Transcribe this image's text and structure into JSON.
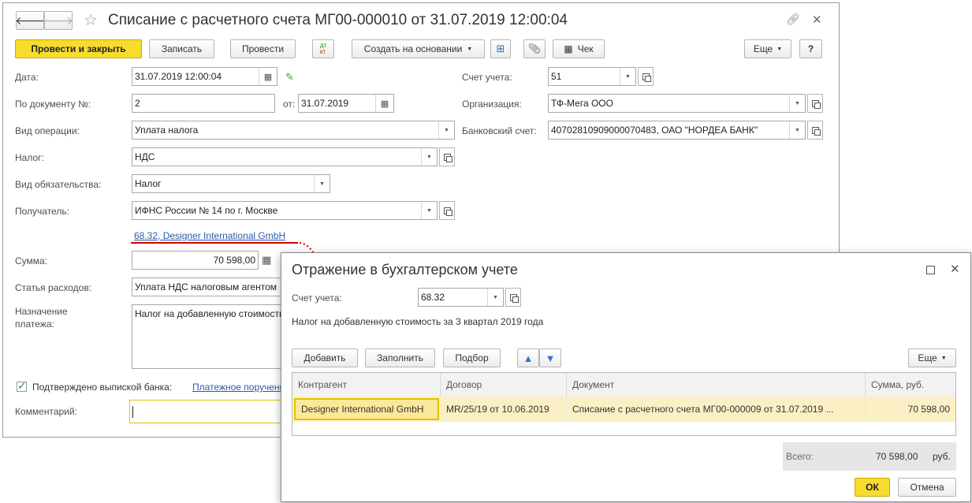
{
  "main": {
    "title": "Списание с расчетного счета МГ00-000010 от 31.07.2019 12:00:04",
    "toolbar": {
      "post_close": "Провести и закрыть",
      "save": "Записать",
      "post": "Провести",
      "dtkt_top": "дт",
      "dtkt_bottom": "кт",
      "create_based": "Создать на основании",
      "check": "Чек",
      "more": "Еще",
      "help": "?"
    },
    "fields": {
      "date_label": "Дата:",
      "date_value": "31.07.2019 12:00:04",
      "docnum_label": "По документу №:",
      "docnum_value": "2",
      "from_label": "от:",
      "from_value": "31.07.2019",
      "optype_label": "Вид операции:",
      "optype_value": "Уплата налога",
      "tax_label": "Налог:",
      "tax_value": "НДС",
      "liability_label": "Вид обязательства:",
      "liability_value": "Налог",
      "recipient_label": "Получатель:",
      "recipient_value": "ИФНС России № 14 по г. Москве",
      "account_link": "68.32, Designer International GmbH",
      "amount_label": "Сумма:",
      "amount_value": "70 598,00",
      "expense_label": "Статья расходов:",
      "expense_value": "Уплата НДС налоговым агентом",
      "purpose_label": "Назначение платежа:",
      "purpose_value": "Налог на добавленную стоимость",
      "bank_confirm": "Подтверждено выпиской банка:",
      "payment_order_link": "Платежное поручение",
      "comment_label": "Комментарий:",
      "comment_value": "",
      "acc_label": "Счет учета:",
      "acc_value": "51",
      "org_label": "Организация:",
      "org_value": "ТФ-Мега ООО",
      "bank_label": "Банковский счет:",
      "bank_value": "40702810909000070483, ОАО \"НОРДЕА БАНК\""
    }
  },
  "dialog": {
    "title": "Отражение в бухгалтерском учете",
    "acc_label": "Счет учета:",
    "acc_value": "68.32",
    "acc_desc": "Налог на добавленную стоимость за 3 квартал 2019 года",
    "toolbar": {
      "add": "Добавить",
      "fill": "Заполнить",
      "pick": "Подбор",
      "more": "Еще"
    },
    "table": {
      "headers": [
        "Контрагент",
        "Договор",
        "Документ",
        "Сумма, руб."
      ],
      "rows": [
        [
          "Designer International GmbH",
          "MR/25/19 от 10.06.2019",
          "Списание с расчетного счета МГ00-000009 от 31.07.2019 ...",
          "70 598,00"
        ]
      ]
    },
    "total_label": "Всего:",
    "total_value": "70 598,00",
    "total_unit": "руб.",
    "ok": "ОК",
    "cancel": "Отмена"
  },
  "colors": {
    "accent_yellow": "#f7dc2d",
    "row_highlight": "#fbf0c5",
    "link_blue": "#2a5ba8",
    "arrow_red": "#d00000"
  }
}
